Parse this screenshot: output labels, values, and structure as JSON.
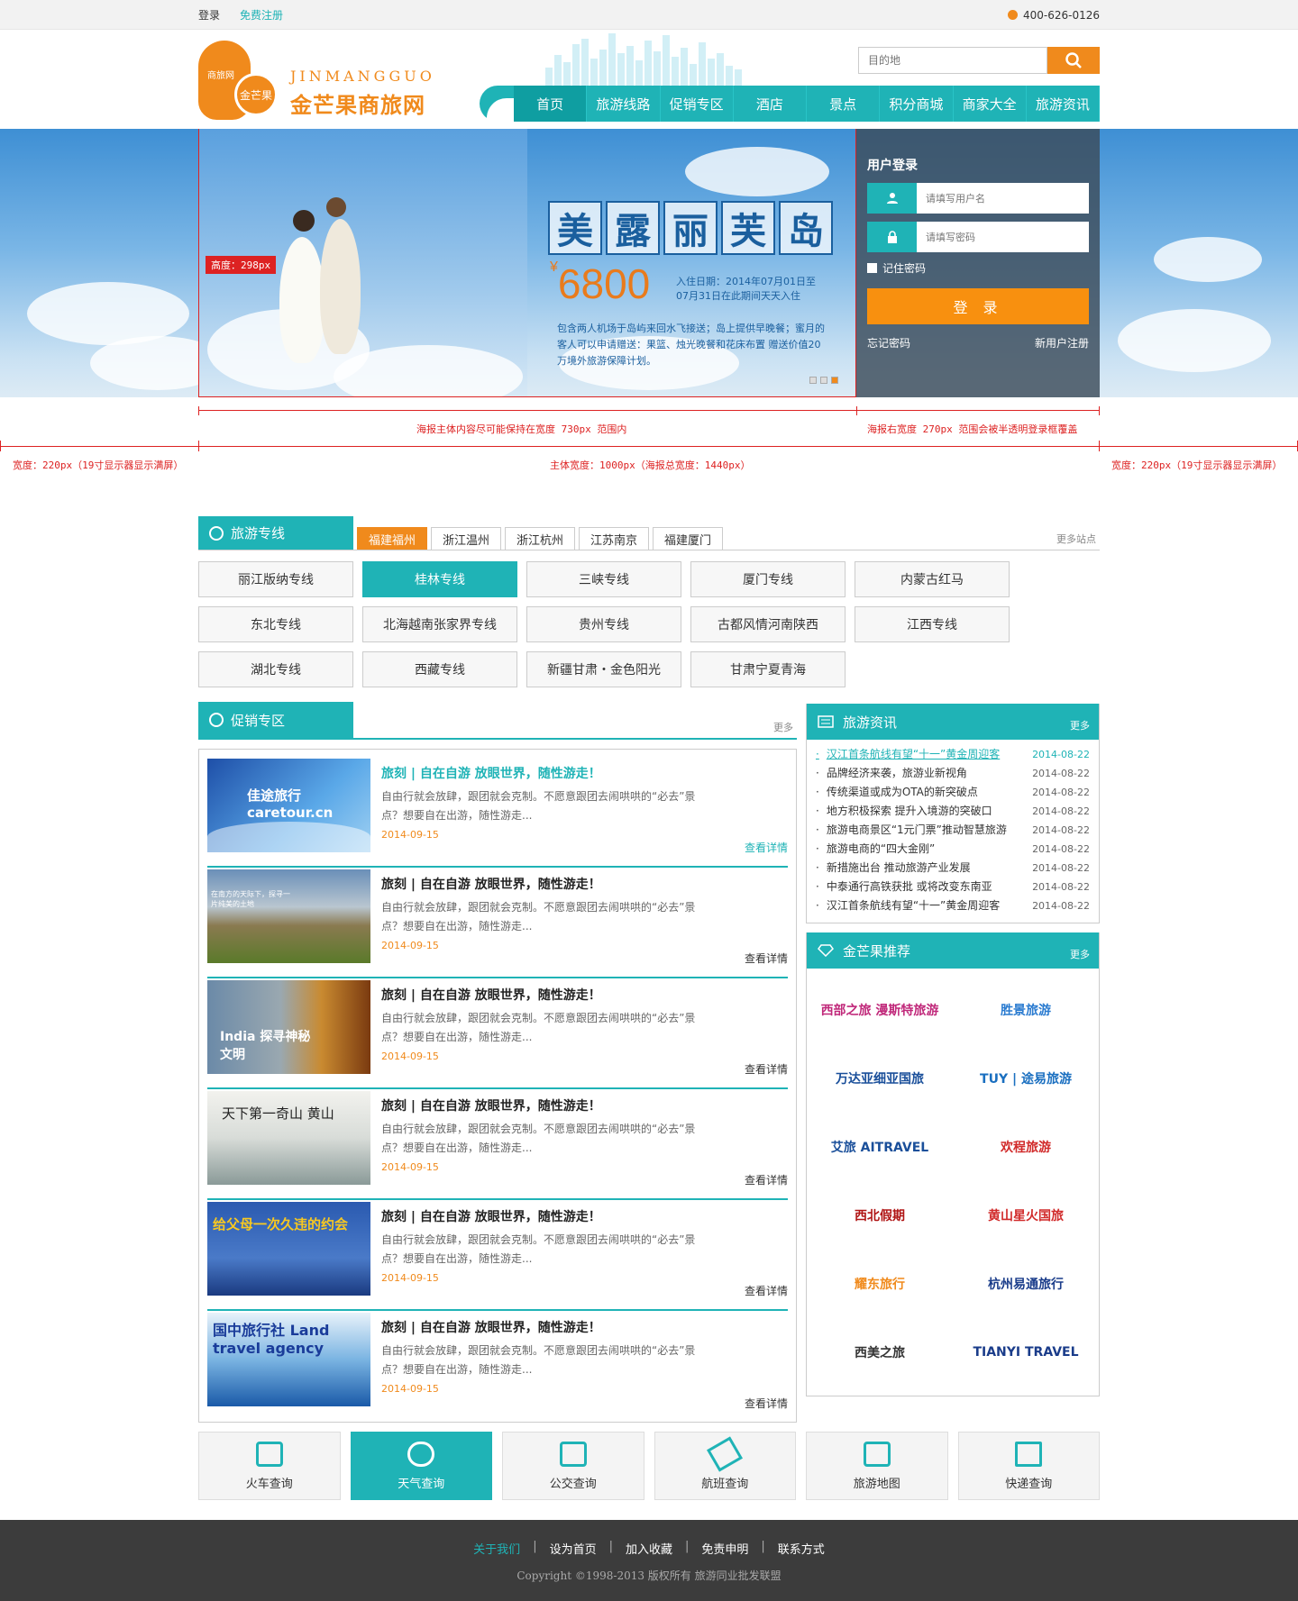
{
  "topbar": {
    "login": "登录",
    "register": "免费注册",
    "phone": "400-626-0126"
  },
  "logo": {
    "blob_text": "商旅网",
    "circle_text": "金芒果",
    "en": "JINMANGGUO",
    "cn": "金芒果商旅网"
  },
  "search": {
    "placeholder": "目的地"
  },
  "nav": [
    "首页",
    "旅游线路",
    "促销专区",
    "酒店",
    "景点",
    "积分商城",
    "商家大全",
    "旅游资讯"
  ],
  "banner": {
    "size_tag": "高度：298px",
    "promo_title": [
      "美",
      "露",
      "丽",
      "芙",
      "岛"
    ],
    "price_sym": "¥",
    "price": "6800",
    "checkin": "入住日期：2014年07月01日至07月31日在此期间天天入住",
    "desc": "包含两人机场于岛屿来回水飞接送；岛上提供早晚餐；蜜月的客人可以申请赠送：果篮、烛光晚餐和花床布置 赠送价值20万境外旅游保障计划。"
  },
  "login": {
    "title": "用户登录",
    "user_placeholder": "请填写用户名",
    "pass_placeholder": "请填写密码",
    "remember": "记住密码",
    "button": "登 录",
    "forgot": "忘记密码",
    "register": "新用户注册"
  },
  "annotations": {
    "main": "海报主体内容尽可能保持在宽度 730px 范围内",
    "right": "海报右宽度 270px 范围会被半透明登录框覆盖",
    "side_left": "宽度：220px（19寸显示器显示满屏）",
    "center": "主体宽度：1000px（海报总宽度：1440px）",
    "side_right": "宽度：220px（19寸显示器显示满屏）"
  },
  "lines": {
    "title": "旅游专线",
    "tabs": [
      "福建福州",
      "浙江温州",
      "浙江杭州",
      "江苏南京",
      "福建厦门"
    ],
    "more": "更多站点",
    "items": [
      "丽江版纳专线",
      "桂林专线",
      "三峡专线",
      "厦门专线",
      "内蒙古红马",
      "东北专线",
      "北海越南张家界专线",
      "贵州专线",
      "古都风情河南陕西",
      "江西专线",
      "湖北专线",
      "西藏专线",
      "新疆甘肃・金色阳光",
      "甘肃宁夏青海"
    ]
  },
  "promo": {
    "title": "促销专区",
    "more": "更多",
    "deal_title": "旅刻 | 自在自游 放眼世界，随性游走！",
    "deal_desc": "自由行就会放肆，跟团就会克制。不愿意跟团去闹哄哄的“必去”景点？想要自在出游，随性游走...",
    "deal_date": "2014-09-15",
    "deal_more": "查看详情",
    "images": [
      "佳途旅行 caretour.cn",
      "在南方的天际下，探寻一片纯美的土地",
      "India 探寻神秘文明",
      "天下第一奇山 黄山",
      "给父母一次久违的约会",
      "国中旅行社 Land travel agency"
    ]
  },
  "news": {
    "title": "旅游资讯",
    "more": "更多",
    "items": [
      {
        "t": "汉江首条航线有望“十一”黄金周迎客",
        "d": "2014-08-22"
      },
      {
        "t": "品牌经济来袭，旅游业新视角",
        "d": "2014-08-22"
      },
      {
        "t": "传统渠道或成为OTA的新突破点",
        "d": "2014-08-22"
      },
      {
        "t": "地方积极探索 提升入境游的突破口",
        "d": "2014-08-22"
      },
      {
        "t": "旅游电商景区“1元门票”推动智慧旅游",
        "d": "2014-08-22"
      },
      {
        "t": "旅游电商的“四大金刚”",
        "d": "2014-08-22"
      },
      {
        "t": "新措施出台 推动旅游产业发展",
        "d": "2014-08-22"
      },
      {
        "t": "中泰通行高铁获批 或将改变东南亚",
        "d": "2014-08-22"
      },
      {
        "t": "汉江首条航线有望“十一”黄金周迎客",
        "d": "2014-08-22"
      }
    ]
  },
  "recommend": {
    "title": "金芒果推荐",
    "more": "更多",
    "items": [
      {
        "name": "西部之旅 漫斯特旅游",
        "color": "#c0287a"
      },
      {
        "name": "胜景旅游",
        "color": "#2a7bd0"
      },
      {
        "name": "万达亚细亚国旅",
        "color": "#1a4f9a"
      },
      {
        "name": "TUY | 途易旅游",
        "color": "#1a6fc0"
      },
      {
        "name": "艾旅 AITRAVEL",
        "color": "#1a4f9a"
      },
      {
        "name": "欢程旅游",
        "color": "#d12a2a"
      },
      {
        "name": "西北假期",
        "color": "#b01515"
      },
      {
        "name": "黄山星火国旅",
        "color": "#d12a2a"
      },
      {
        "name": "耀东旅行",
        "color": "#f08a1c"
      },
      {
        "name": "杭州易通旅行",
        "color": "#1a3c8a"
      },
      {
        "name": "西美之旅",
        "color": "#333333"
      },
      {
        "name": "TIANYI TRAVEL",
        "color": "#1a3c8a"
      }
    ]
  },
  "tools": [
    "火车查询",
    "天气查询",
    "公交查询",
    "航班查询",
    "旅游地图",
    "快递查询"
  ],
  "footer": {
    "links": [
      "关于我们",
      "设为首页",
      "加入收藏",
      "免责申明",
      "联系方式"
    ],
    "copyright": "Copyright ©1998-2013 版权所有 旅游同业批发联盟"
  },
  "colors": {
    "teal": "#1fb3b6",
    "orange": "#f08a1c",
    "red_annotation": "#dd2222"
  }
}
